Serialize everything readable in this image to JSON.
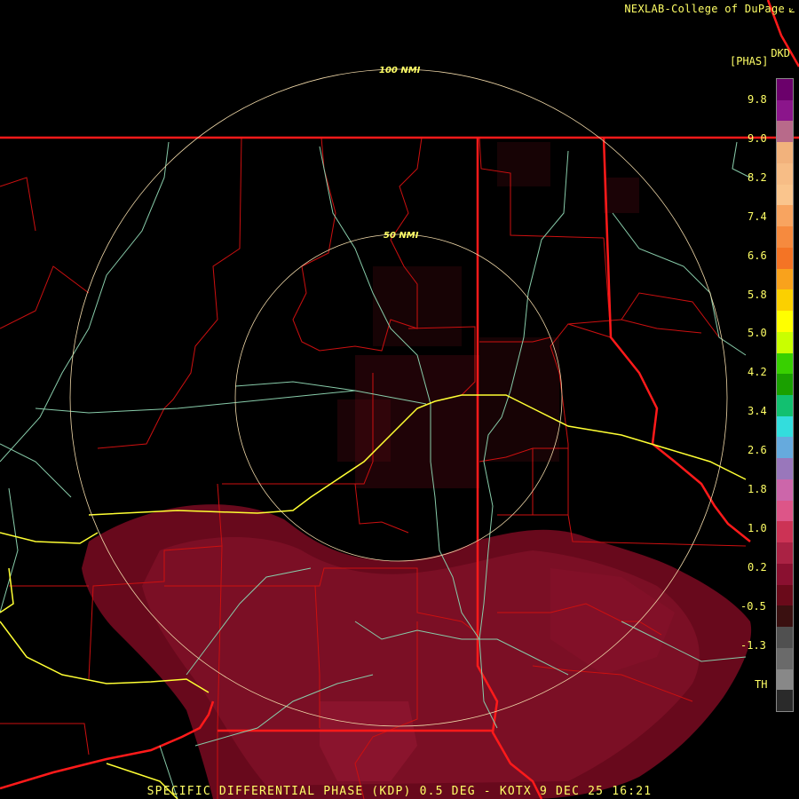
{
  "header": {
    "credit": "NEXLAB-College of DuPage",
    "logo_mark": "⟀",
    "product_code": "DKD",
    "units": "[PHAS]"
  },
  "footer": {
    "caption": "SPECIFIC DIFFERENTIAL PHASE (KDP) 0.5 DEG - KOTX 9 DEC 25 16:21"
  },
  "range_rings": {
    "inner_label": "50 NMI",
    "outer_label": "100 NMI"
  },
  "colorbar": {
    "labels": [
      "9.8",
      "9.0",
      "8.2",
      "7.4",
      "6.6",
      "5.8",
      "5.0",
      "4.2",
      "3.4",
      "2.6",
      "1.8",
      "1.0",
      "0.2",
      "-0.5",
      "-1.3",
      "TH"
    ],
    "colors": [
      "#6b006b",
      "#8b158b",
      "#b86a8a",
      "#f2b27c",
      "#f7bd86",
      "#fac58d",
      "#f8a460",
      "#f68a3e",
      "#f47425",
      "#f9a21c",
      "#fbd000",
      "#ffff00",
      "#c9ff00",
      "#38d000",
      "#1aa000",
      "#12c070",
      "#33dddd",
      "#66aadd",
      "#9977bb",
      "#cc66aa",
      "#dd5588",
      "#cc3355",
      "#aa2244",
      "#8a1030",
      "#6a0a1a",
      "#3a1010",
      "#505050",
      "#6a6a6a",
      "#888888",
      "#2a2a2a"
    ]
  },
  "colors": {
    "state_border": "#ff2222",
    "county_border": "#dd1111",
    "highway_interstate": "#ffff44",
    "highway": "#88ddaa",
    "ring": "#f0d8a8",
    "echo": "#7a0a20",
    "text": "#ffff66"
  }
}
